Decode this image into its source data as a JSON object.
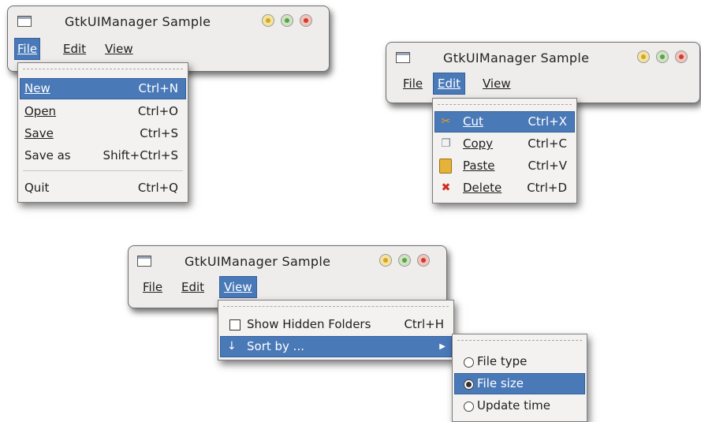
{
  "window_title": "GtkUIManager Sample",
  "menubar": {
    "file": "File",
    "edit": "Edit",
    "view": "View"
  },
  "file_menu": {
    "items": [
      {
        "label": "New",
        "accel": "Ctrl+N"
      },
      {
        "label": "Open",
        "accel": "Ctrl+O"
      },
      {
        "label": "Save",
        "accel": "Ctrl+S"
      },
      {
        "label": "Save as",
        "accel": "Shift+Ctrl+S"
      },
      {
        "label": "Quit",
        "accel": "Ctrl+Q"
      }
    ]
  },
  "edit_menu": {
    "items": [
      {
        "label": "Cut",
        "accel": "Ctrl+X",
        "icon": "scissors-icon"
      },
      {
        "label": "Copy",
        "accel": "Ctrl+C",
        "icon": "copy-icon"
      },
      {
        "label": "Paste",
        "accel": "Ctrl+V",
        "icon": "paste-icon"
      },
      {
        "label": "Delete",
        "accel": "Ctrl+D",
        "icon": "delete-icon"
      }
    ]
  },
  "view_menu": {
    "show_hidden": {
      "label": "Show Hidden Folders",
      "accel": "Ctrl+H",
      "checked": false
    },
    "sort_by": {
      "label": "Sort by ...",
      "icon": "sort-descending-icon"
    }
  },
  "sort_submenu": {
    "items": [
      {
        "label": "File type",
        "selected": false
      },
      {
        "label": "File size",
        "selected": true
      },
      {
        "label": "Update time",
        "selected": false
      }
    ]
  },
  "colors": {
    "selection": "#4a79b8",
    "window_bg": "#eeedeb",
    "menu_bg": "#f3f2f0"
  }
}
